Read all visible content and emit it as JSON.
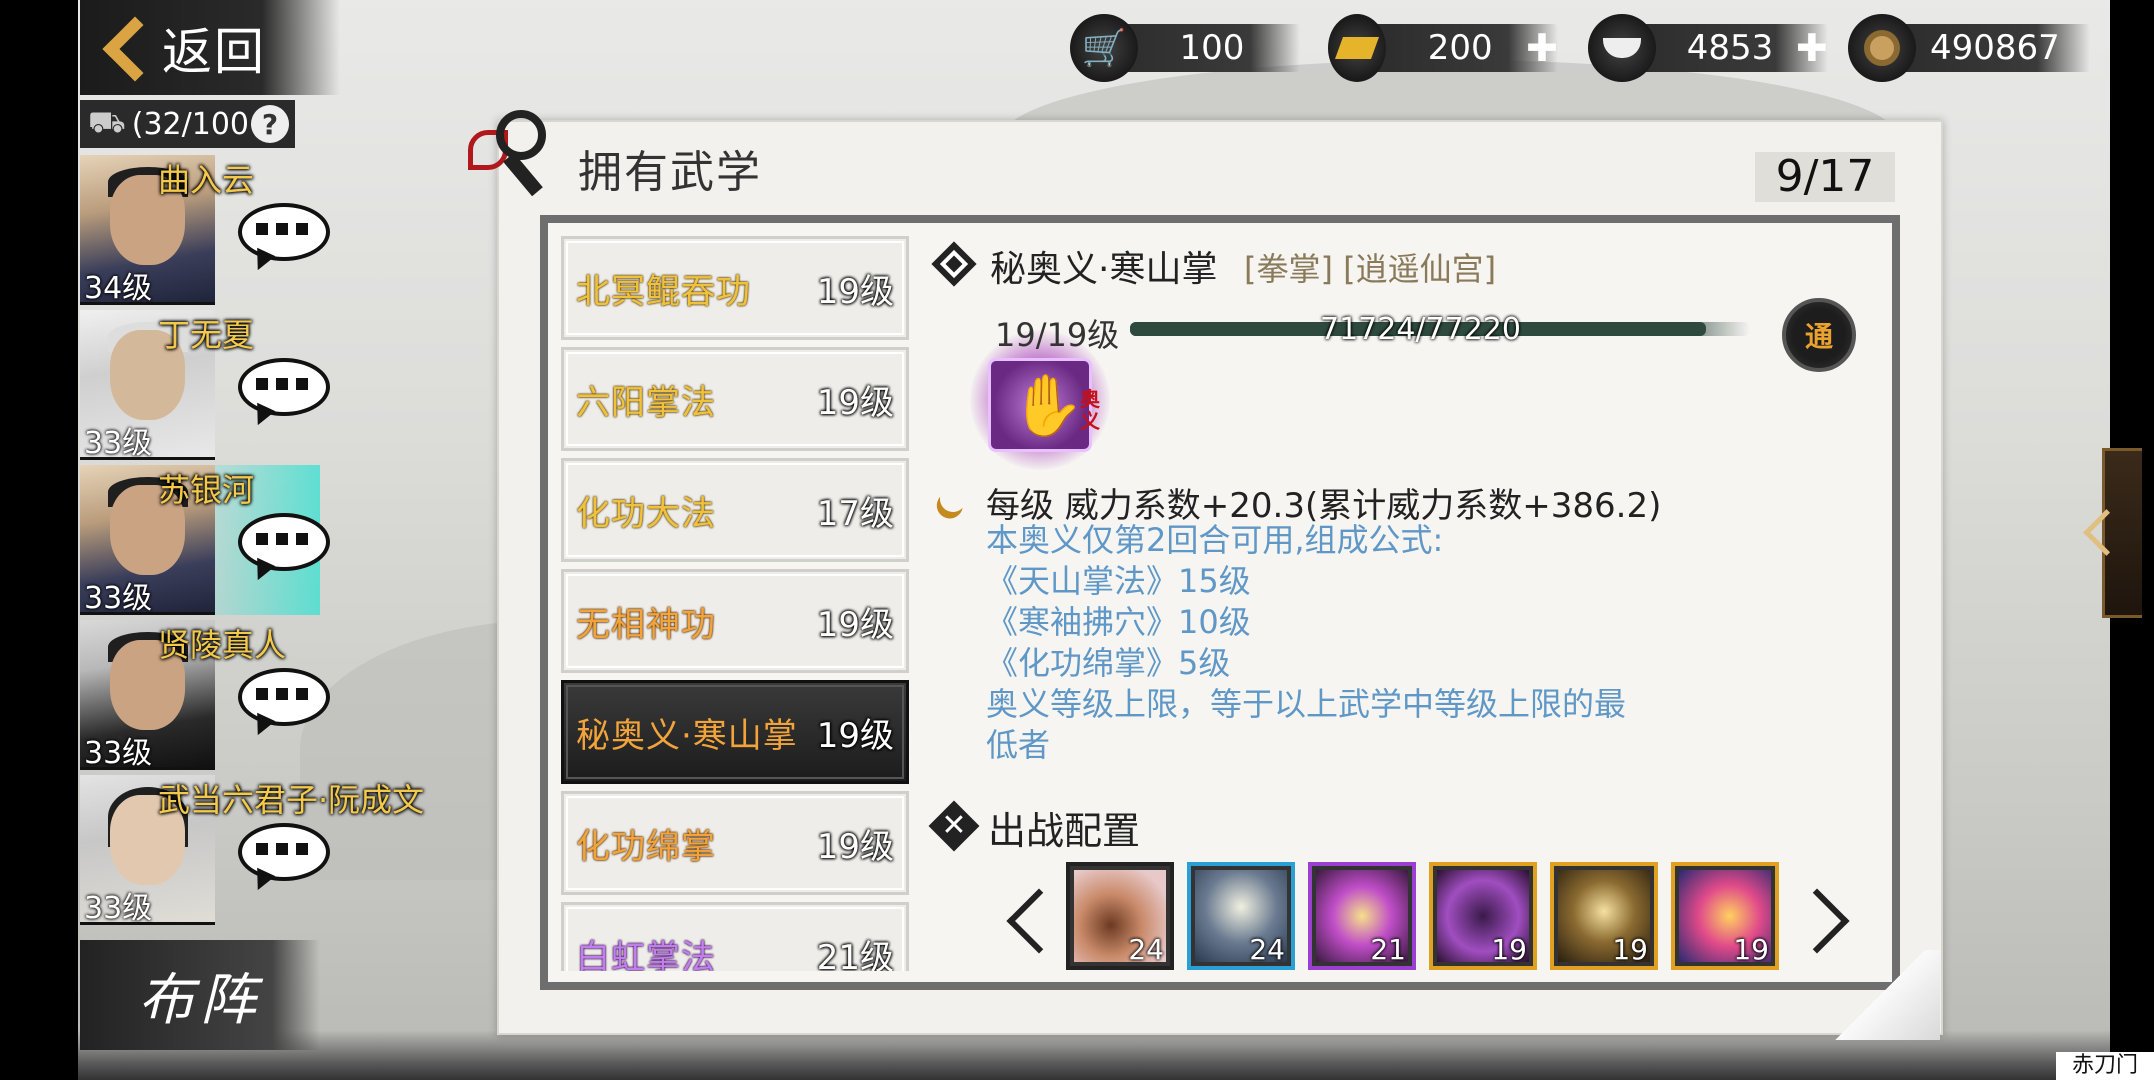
{
  "topbar": {
    "back_label": "返回",
    "resources": [
      {
        "name": "stamina",
        "icon": "cart-icon",
        "value": "100",
        "has_plus": false
      },
      {
        "name": "gold",
        "icon": "gold-bar-icon",
        "value": "200",
        "has_plus": true
      },
      {
        "name": "silver",
        "icon": "silver-ingot-icon",
        "value": "4853",
        "has_plus": true
      },
      {
        "name": "coins",
        "icon": "copper-coin-icon",
        "value": "490867",
        "has_plus": false
      }
    ]
  },
  "roster": {
    "bag_count": "(32/100",
    "help": "?",
    "heroes": [
      {
        "name": "曲入云",
        "level": "34级",
        "selected": false
      },
      {
        "name": "丁无夏",
        "level": "33级",
        "selected": false
      },
      {
        "name": "苏银河",
        "level": "33级",
        "selected": true
      },
      {
        "name": "贤陵真人",
        "level": "33级",
        "selected": false
      },
      {
        "name": "武当六君子·阮成文",
        "level": "33级",
        "selected": false
      }
    ],
    "formation_label": "布阵"
  },
  "panel": {
    "title": "拥有武学",
    "page_count": "9/17"
  },
  "skills": [
    {
      "name": "北冥鲲吞功",
      "level": "19级",
      "color": "gold"
    },
    {
      "name": "六阳掌法",
      "level": "19级",
      "color": "gold"
    },
    {
      "name": "化功大法",
      "level": "17级",
      "color": "gold"
    },
    {
      "name": "无相神功",
      "level": "19级",
      "color": "orange"
    },
    {
      "name": "秘奥义·寒山掌",
      "level": "19级",
      "color": "orange",
      "active": true
    },
    {
      "name": "化功绵掌",
      "level": "19级",
      "color": "orange"
    },
    {
      "name": "白虹掌法",
      "level": "21级",
      "color": "purple"
    }
  ],
  "detail": {
    "title": "秘奥义·寒山掌",
    "tags": "[拳掌] [逍遥仙宫]",
    "level": "19/19级",
    "xp_text": "71724/77220",
    "xp_fraction": 0.929,
    "badge": "通",
    "icon_tag": "奥义",
    "effect": "每级  威力系数+20.3(累计威力系数+386.2)",
    "desc": [
      "本奥义仅第2回合可用,组成公式:",
      "《天山掌法》15级",
      "《寒袖拂穴》10级",
      "《化功绵掌》5级",
      "奥义等级上限，等于以上武学中等级上限的最",
      "低者"
    ]
  },
  "loadout": {
    "title": "出战配置",
    "slots": [
      {
        "level": "24",
        "border": "#222222",
        "art": "claw-fist-icon"
      },
      {
        "level": "24",
        "border": "#2a9fd6",
        "art": "kick-figure-icon"
      },
      {
        "level": "21",
        "border": "#9b3fd0",
        "art": "burst-icon"
      },
      {
        "level": "19",
        "border": "#e0a020",
        "art": "palm-icon"
      },
      {
        "level": "19",
        "border": "#e0a020",
        "art": "meditation-icon"
      },
      {
        "level": "19",
        "border": "#e0a020",
        "art": "phoenix-icon"
      }
    ]
  },
  "footer": {
    "corner_label": "赤刀门"
  },
  "colors": {
    "gold_text": "#f0c23b",
    "orange_text": "#f2a43a",
    "purple_text": "#c27ef0",
    "desc_blue": "#5f97c6",
    "accent_teal": "#40e0d0"
  }
}
